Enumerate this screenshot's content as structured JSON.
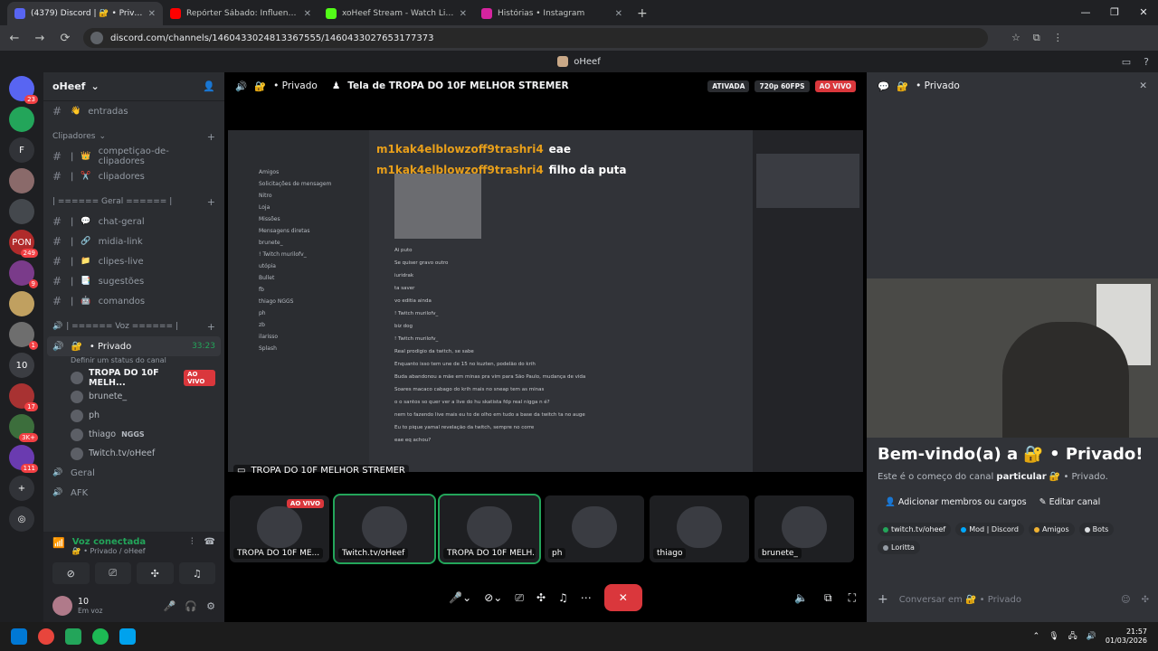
{
  "browser": {
    "tabs": [
      {
        "title": "(4379) Discord | 🔐 • Privad",
        "color": "#5865f2",
        "active": true
      },
      {
        "title": "Repórter Sábado: Influencers p",
        "color": "#ff0000",
        "active": false
      },
      {
        "title": "xoHeef Stream - Watch Live on",
        "color": "#53fc18",
        "active": false
      },
      {
        "title": "Histórias • Instagram",
        "color": "#d6249f",
        "active": false
      }
    ],
    "url": "discord.com/channels/1460433024813367555/1460433027653177373"
  },
  "app_title": "oHeef",
  "servers": [
    {
      "label": "",
      "badge": "23",
      "color": "#5865f2"
    },
    {
      "label": "",
      "badge": "",
      "color": "#23a55a"
    },
    {
      "label": "F",
      "badge": "",
      "color": "#313338"
    },
    {
      "label": "",
      "badge": "",
      "color": "#8a6a6a"
    },
    {
      "label": "",
      "badge": "",
      "color": "#44484d"
    },
    {
      "label": "PON",
      "badge": "249",
      "color": "#b02b2b"
    },
    {
      "label": "",
      "badge": "9",
      "color": "#7a3b8a"
    },
    {
      "label": "",
      "badge": "",
      "color": "#c0a060"
    },
    {
      "label": "",
      "badge": "1",
      "color": "#6e6e6e"
    },
    {
      "label": "10",
      "badge": "",
      "color": "#3b3d42"
    },
    {
      "label": "",
      "badge": "17",
      "color": "#a83232"
    },
    {
      "label": "",
      "badge": "3K+",
      "color": "#3c6e3c"
    },
    {
      "label": "",
      "badge": "111",
      "color": "#6a3bb0"
    }
  ],
  "sidebar": {
    "guild_name": "oHeef",
    "channels_top": [
      {
        "emoji": "👋",
        "name": "entradas"
      }
    ],
    "cat1": "Clipadores",
    "cat1_channels": [
      {
        "emoji": "👑",
        "name": "competiçao-de-clipadores"
      },
      {
        "emoji": "✂️",
        "name": "clipadores"
      }
    ],
    "cat2": "| ====== Geral ====== |",
    "cat2_channels": [
      {
        "emoji": "💬",
        "name": "chat-geral"
      },
      {
        "emoji": "🔗",
        "name": "midia-link"
      },
      {
        "emoji": "📁",
        "name": "clipes-live"
      },
      {
        "emoji": "📑",
        "name": "sugestões"
      },
      {
        "emoji": "🤖",
        "name": "comandos"
      }
    ],
    "cat3": "| ====== Voz ====== |",
    "active_voice": {
      "name": "• Privado",
      "time": "33:23",
      "status": "Definir um status do canal"
    },
    "voice_users": [
      {
        "name": "TROPA DO 10F MELH...",
        "tag": "AO VIVO",
        "strong": true
      },
      {
        "name": "brunete_",
        "tag": "",
        "strong": false
      },
      {
        "name": "ph",
        "tag": "",
        "strong": false
      },
      {
        "name": "thiago",
        "tag": "NGGS",
        "strong": false
      },
      {
        "name": "Twitch.tv/oHeef",
        "tag": "",
        "strong": false
      }
    ],
    "other_voice": [
      {
        "name": "Geral"
      },
      {
        "name": "AFK"
      }
    ],
    "voice_connected": "Voz conectada",
    "voice_connected_sub": "🔐 • Privado / oHeef",
    "user": {
      "name": "10",
      "status": "Em voz"
    }
  },
  "stage": {
    "channel": "• Privado",
    "stream_title": "Tela de TROPA DO 10F MELHOR STREMER",
    "badge_active": "ATIVADA",
    "quality": "720p 60FPS",
    "live": "AO VIVO",
    "caption": "TROPA DO 10F MELHOR STREMER",
    "chat": [
      {
        "user": "m1kak4elblowzoff9trashri4",
        "msg": "eae"
      },
      {
        "user": "m1kak4elblowzoff9trashri4",
        "msg": "filho da puta"
      }
    ],
    "screen_small": [
      "Ai puto",
      "Se quiser gravo outro",
      "iuridrak",
      "ta saver",
      "vo editia ainda",
      "! Twitch murilofv_",
      "biz dog",
      "! Twitch murilofv_",
      "Real prodigio da twitch, se sabe",
      "Enquanto isso tem une de 15 no kuzten, podelão do krih",
      "Buda abandonou a mãe em minas pra vim para São Paulo, mudança de vida",
      "Soares macaco cabago do krih mais no sneap tem as minas",
      "o o santos so quer ver a live do hu skatista fdp real nigga n é?",
      "nem to fazendo live mais eu to de olho em tudo a base da twitch ta no auge",
      "Eu to pique yamal revelação da twitch, sempre no corre",
      "eae eq achou?"
    ],
    "tiles": [
      {
        "label": "TROPA DO 10F ME...",
        "live": "AO VIVO",
        "selected": false
      },
      {
        "label": "Twitch.tv/oHeef",
        "live": "",
        "selected": true
      },
      {
        "label": "TROPA DO 10F MELH...",
        "live": "",
        "selected": true
      },
      {
        "label": "ph",
        "live": "",
        "selected": false
      },
      {
        "label": "thiago",
        "live": "",
        "selected": false
      },
      {
        "label": "brunete_",
        "live": "",
        "selected": false
      }
    ]
  },
  "rpanel": {
    "channel": "• Privado",
    "welcome_title": "Bem-vindo(a) a 🔐 • Privado!",
    "welcome_sub_pre": "Este é o começo do canal",
    "welcome_sub_bold": "particular",
    "welcome_sub_post": "🔐 • Privado.",
    "add_members": "Adicionar membros ou cargos",
    "edit_channel": "Editar canal",
    "tags": [
      {
        "name": "twitch.tv/oheef",
        "color": "#23a55a"
      },
      {
        "name": "Mod | Discord",
        "color": "#00a8fc"
      },
      {
        "name": "Amigos",
        "color": "#f0b232"
      },
      {
        "name": "Bots",
        "color": "#dbdee1"
      },
      {
        "name": "Loritta",
        "color": "#949ba4"
      }
    ],
    "composer_placeholder": "Conversar em 🔐 • Privado"
  },
  "taskbar": {
    "time": "21:57",
    "date": "01/03/2026"
  }
}
